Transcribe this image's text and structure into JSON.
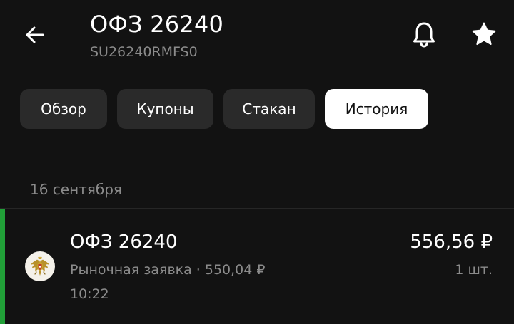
{
  "header": {
    "title": "ОФЗ 26240",
    "ticker": "SU26240RMFS0",
    "back_icon": "arrow-left-icon",
    "bell_icon": "bell-icon",
    "star_icon": "star-icon"
  },
  "tabs": [
    {
      "label": "Обзор",
      "active": false
    },
    {
      "label": "Купоны",
      "active": false
    },
    {
      "label": "Стакан",
      "active": false
    },
    {
      "label": "История",
      "active": true
    }
  ],
  "history": {
    "date_header": "16 сентября",
    "transactions": [
      {
        "name": "ОФЗ 26240",
        "detail": "Рыночная заявка · 550,04 ₽",
        "time": "10:22",
        "amount": "556,56 ₽",
        "quantity": "1 шт.",
        "icon": "russia-coat-of-arms-icon",
        "accent_color": "#21a038"
      }
    ]
  },
  "colors": {
    "background": "#121212",
    "tab_inactive": "#2a2a2a",
    "tab_active": "#ffffff",
    "secondary_text": "#8b8b8b",
    "buy_accent": "#21a038"
  }
}
